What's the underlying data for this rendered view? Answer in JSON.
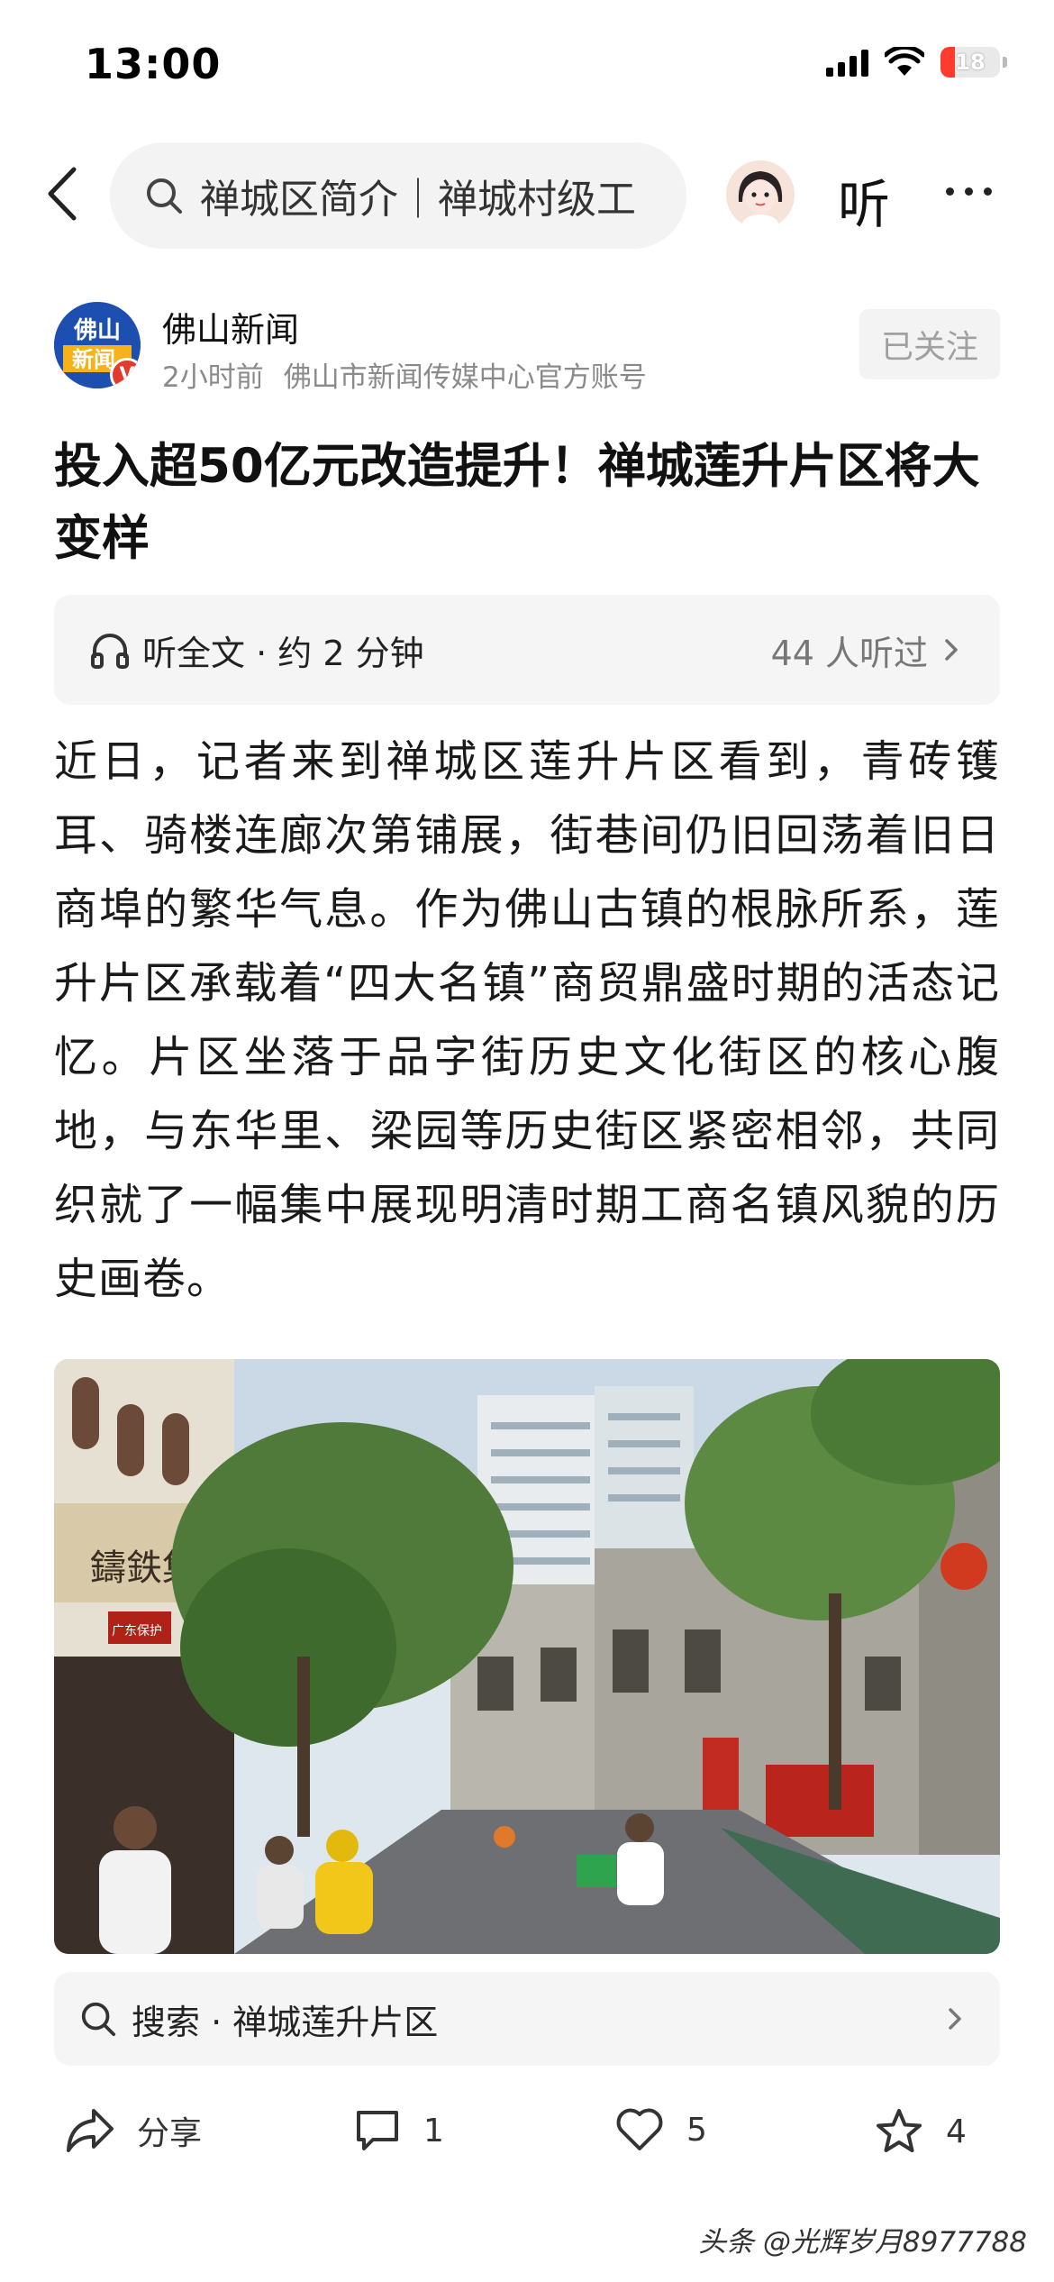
{
  "status_bar": {
    "time": "13:00",
    "battery_level": "18",
    "icons": [
      "signal-icon",
      "wifi-icon",
      "battery-icon"
    ]
  },
  "nav": {
    "search_query": "禅城区简介｜禅城村级工",
    "listen_label": "听",
    "icons": [
      "back-icon",
      "search-icon",
      "avatar",
      "more-icon"
    ]
  },
  "author": {
    "logo_text_1": "佛山",
    "logo_text_2": "新闻",
    "name": "佛山新闻",
    "time_ago": "2小时前",
    "description": "佛山市新闻传媒中心官方账号",
    "follow_label": "已关注"
  },
  "article": {
    "title": "投入超50亿元改造提升！禅城莲升片区将大变样",
    "body": "近日，记者来到禅城区莲升片区看到，青砖镬耳、骑楼连廊次第铺展，街巷间仍旧回荡着旧日商埠的繁华气息。作为佛山古镇的根脉所系，莲升片区承载着“四大名镇”商贸鼎盛时期的活态记忆。片区坐落于品字街历史文化街区的核心腹地，与东华里、梁园等历史街区紧密相邻，共同织就了一幅集中展现明清时期工商名镇风貌的历史画卷。"
  },
  "listen_bar": {
    "label": "听全文 · 约 2 分钟",
    "count": "44 人听过"
  },
  "photo": {
    "sign_text": "鑄鉄集",
    "red_sign_text": "广东保护"
  },
  "related_search": {
    "label": "搜索 · 禅城莲升片区"
  },
  "actions": {
    "share_label": "分享",
    "comment_count": "1",
    "like_count": "5",
    "favorite_count": "4"
  },
  "watermark": "头条 @光辉岁月8977788",
  "colors": {
    "accent_red": "#e23b2c",
    "logo_blue": "#1d4fb0",
    "muted_text": "#8a8a8a",
    "pill_bg": "#f5f5f5"
  }
}
